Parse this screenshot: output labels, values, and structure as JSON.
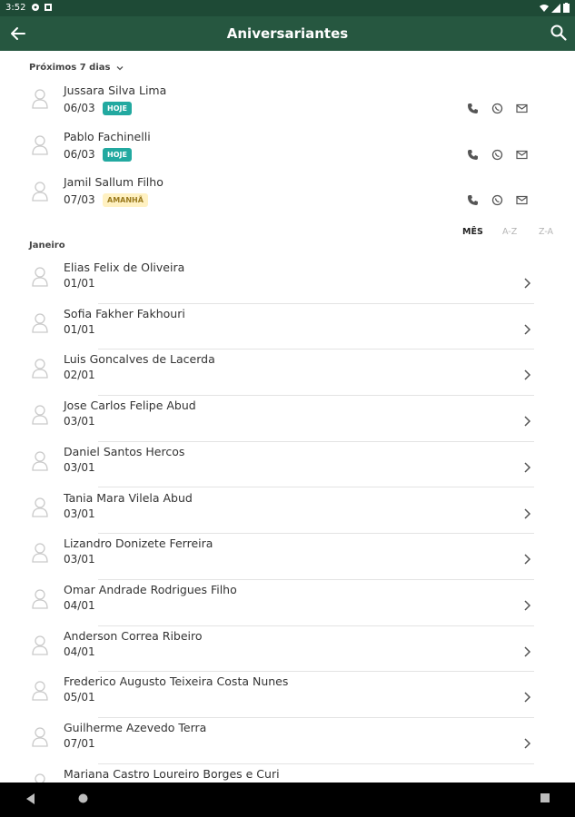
{
  "status_bar": {
    "time": "3:52"
  },
  "app_bar": {
    "title": "Aniversariantes"
  },
  "upcoming": {
    "label": "Próximos 7 dias",
    "items": [
      {
        "name": "Jussara Silva Lima",
        "date": "06/03",
        "badge": "HOJE"
      },
      {
        "name": "Pablo Fachinelli",
        "date": "06/03",
        "badge": "HOJE"
      },
      {
        "name": "Jamil Sallum Filho",
        "date": "07/03",
        "badge": "AMANHÃ"
      }
    ]
  },
  "sort_tabs": [
    {
      "label": "MÊS",
      "active": true
    },
    {
      "label": "A-Z",
      "active": false
    },
    {
      "label": "Z-A",
      "active": false
    }
  ],
  "month_section": {
    "label": "Janeiro",
    "items": [
      {
        "name": "Elias Felix de Oliveira",
        "date": "01/01"
      },
      {
        "name": "Sofia Fakher Fakhouri",
        "date": "01/01"
      },
      {
        "name": "Luis Goncalves de Lacerda",
        "date": "02/01"
      },
      {
        "name": "Jose Carlos Felipe Abud",
        "date": "03/01"
      },
      {
        "name": "Daniel Santos Hercos",
        "date": "03/01"
      },
      {
        "name": "Tania Mara Vilela Abud",
        "date": "03/01"
      },
      {
        "name": "Lizandro Donizete Ferreira",
        "date": "03/01"
      },
      {
        "name": "Omar Andrade Rodrigues Filho",
        "date": "04/01"
      },
      {
        "name": "Anderson Correa Ribeiro",
        "date": "04/01"
      },
      {
        "name": "Frederico Augusto Teixeira Costa Nunes",
        "date": "05/01"
      },
      {
        "name": "Guilherme Azevedo Terra",
        "date": "07/01"
      },
      {
        "name": "Mariana Castro Loureiro Borges e Curi",
        "date": ""
      }
    ]
  },
  "colors": {
    "app_bar": "#265740",
    "status_bar": "#1e4a36",
    "badge_today": "#22a9a0",
    "badge_tomorrow": "#fff1c2"
  }
}
